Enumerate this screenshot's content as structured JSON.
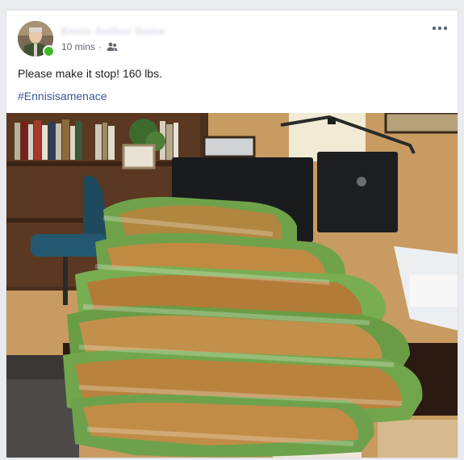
{
  "post": {
    "author": "Ennis Author Name",
    "timestamp": "10 mins",
    "separator": "·",
    "audience_icon": "friends-icon",
    "text": "Please make it stop! 160 lbs.",
    "hashtag": "#Ennisisamenace",
    "more_icon": "more-options-icon",
    "online_status": "online"
  },
  "colors": {
    "link": "#385898",
    "meta": "#616770",
    "online": "#42b72a",
    "bag_green": "#6fa24a",
    "rice_brown": "#b8843f"
  }
}
